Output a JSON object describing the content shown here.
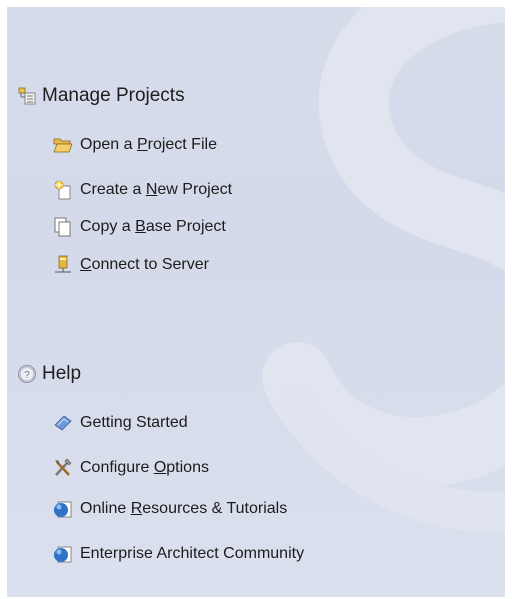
{
  "manage": {
    "title": "Manage Projects",
    "icon": "tree-icon",
    "items": [
      {
        "pre": "Open a ",
        "key": "P",
        "post": "roject File",
        "icon": "folder-open-icon"
      },
      {
        "pre": "Create a ",
        "key": "N",
        "post": "ew Project",
        "icon": "new-project-icon"
      },
      {
        "pre": "Copy a ",
        "key": "B",
        "post": "ase Project",
        "icon": "copy-icon"
      },
      {
        "pre": "",
        "key": "C",
        "post": "onnect to Server",
        "icon": "server-icon"
      }
    ]
  },
  "help": {
    "title": "Help",
    "icon": "help-icon",
    "items": [
      {
        "pre": "Getting Started",
        "key": "",
        "post": "",
        "icon": "book-icon"
      },
      {
        "pre": "Configure ",
        "key": "O",
        "post": "ptions",
        "icon": "tools-icon"
      },
      {
        "pre": "Online ",
        "key": "R",
        "post": "esources & Tutorials",
        "icon": "globe-icon"
      },
      {
        "pre": "Enterprise Architect Community",
        "key": "",
        "post": "",
        "icon": "globe-icon"
      }
    ]
  },
  "colors": {
    "background": "#d6dcea",
    "text": "#1c1c1c",
    "accent": "#2f73c8"
  }
}
